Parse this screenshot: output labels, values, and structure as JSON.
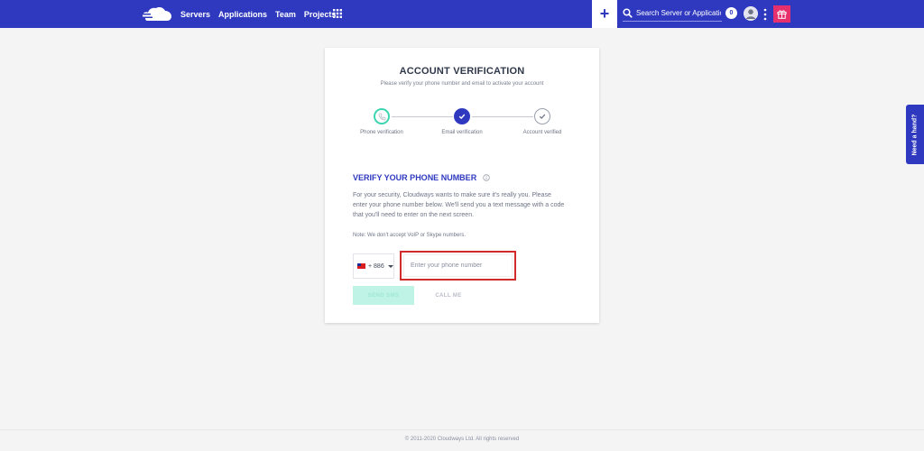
{
  "nav": {
    "items": [
      {
        "label": "Servers"
      },
      {
        "label": "Applications"
      },
      {
        "label": "Team"
      },
      {
        "label": "Projects"
      }
    ],
    "plus_label": "+",
    "search_placeholder": "Search Server or Application",
    "badge_count": "0"
  },
  "verification": {
    "title": "ACCOUNT VERIFICATION",
    "subtitle": "Please verify your phone number and email to activate your account",
    "steps": [
      {
        "label": "Phone verification"
      },
      {
        "label": "Email verification"
      },
      {
        "label": "Account verified"
      }
    ]
  },
  "phone": {
    "section_title": "VERIFY YOUR PHONE NUMBER",
    "description": "For your security, Cloudways wants to make sure it's really you. Please enter your phone number below. We'll send you a text message with a code that you'll need to enter on the next screen.",
    "note": "Note: We don't accept VoIP or Skype numbers.",
    "country_code": "+ 886",
    "input_placeholder": "Enter your phone number",
    "input_value": "",
    "send_label": "SEND SMS",
    "call_label": "CALL ME"
  },
  "side_tab": {
    "label": "Need a hand?"
  },
  "footer": {
    "text": "© 2011-2020 Cloudways Ltd. All rights reserved"
  },
  "colors": {
    "brand": "#2f39bf",
    "accent_green": "#3ed6b0",
    "highlight_red": "#d22b2b",
    "gift": "#e6306e"
  }
}
